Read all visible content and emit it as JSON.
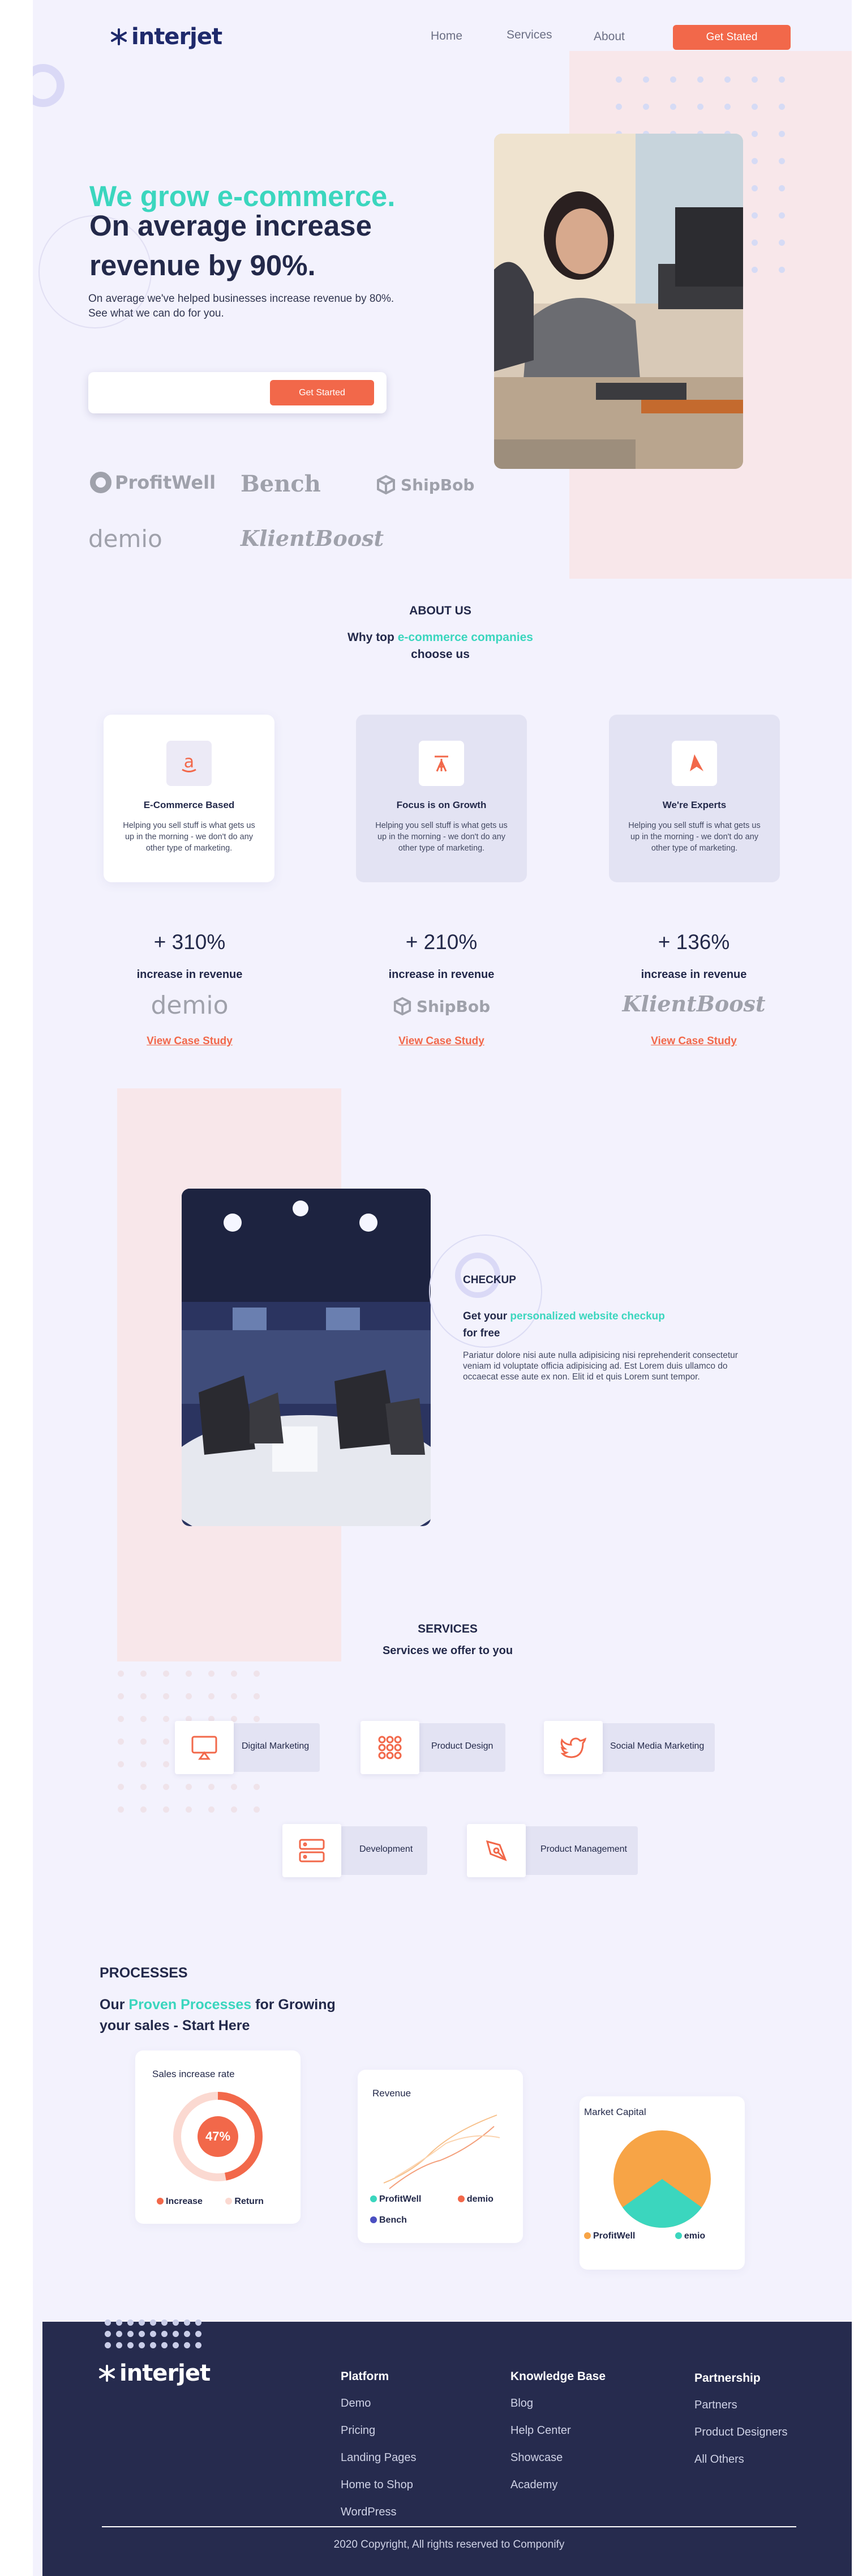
{
  "brand": {
    "logo_text": "interjet"
  },
  "nav": {
    "items": [
      "Home",
      "Services",
      "About"
    ],
    "cta": "Get Stated"
  },
  "hero": {
    "line1": "We grow e-commerce.",
    "line2": "On average increase",
    "line3": "revenue by 90%.",
    "sub1": "On average we've helped businesses increase revenue by 80%.",
    "sub2": "See what we can do for you.",
    "input_value": "",
    "cta": "Get Started"
  },
  "logos": [
    "ProfitWell",
    "Bench",
    "ShipBob",
    "demio",
    "KlientBoost"
  ],
  "about": {
    "eyebrow": "ABOUT US",
    "head_pre": "Why top ",
    "head_hl": "e-commerce companies",
    "head_post": "choose us",
    "cards": [
      {
        "title": "E-Commerce Based",
        "desc": "Helping you sell stuff is what gets us up in the morning - we don't do any other type of marketing."
      },
      {
        "title": "Focus is on Growth",
        "desc": "Helping you sell stuff is what gets us up in the morning - we don't do any other type of marketing."
      },
      {
        "title": "We're Experts",
        "desc": "Helping you sell stuff is what gets us up in the morning - we don't do any other type of marketing."
      }
    ]
  },
  "stats": [
    {
      "value": "+ 310%",
      "label": "increase in revenue",
      "brand": "demio",
      "link": "View Case Study"
    },
    {
      "value": "+ 210%",
      "label": "increase in revenue",
      "brand": "ShipBob",
      "link": "View Case Study"
    },
    {
      "value": "+ 136%",
      "label": "increase in revenue",
      "brand": "KlientBoost",
      "link": "View Case Study"
    }
  ],
  "checkup": {
    "eyebrow": "CHECKUP",
    "head_pre": "Get your ",
    "head_hl": "personalized website checkup",
    "head_post": "for free",
    "body": "Pariatur dolore nisi aute nulla adipisicing nisi reprehenderit consectetur veniam id voluptate officia adipisicing ad. Est Lorem duis ullamco do occaecat esse aute ex non. Elit id et quis Lorem sunt tempor."
  },
  "services": {
    "eyebrow": "SERVICES",
    "head": "Services we offer to you",
    "items": [
      "Digital Marketing",
      "Product Design",
      "Social Media Marketing",
      "Development",
      "Product Management"
    ]
  },
  "processes": {
    "eyebrow": "PROCESSES",
    "head_pre": "Our ",
    "head_hl": "Proven Processes",
    "head_post": " for Growing",
    "head_line2": "your sales - Start Here",
    "cards": {
      "sales": {
        "title": "Sales increase rate",
        "percent_label": "47%",
        "percent": 0.47,
        "legend": [
          "Increase",
          "Return"
        ]
      },
      "revenue": {
        "title": "Revenue",
        "legend": [
          "ProfitWell",
          "demio",
          "Bench"
        ]
      },
      "market": {
        "title": "Market Capital",
        "legend": [
          "ProfitWell",
          "emio"
        ]
      }
    }
  },
  "colors": {
    "accent": "#f2684a",
    "teal": "#3bd6be",
    "navy": "#262b4e",
    "bg": "#f3f2fd"
  },
  "footer": {
    "logo_text": "interjet",
    "cols": [
      {
        "head": "Platform",
        "links": [
          "Demo",
          "Pricing",
          "Landing Pages",
          "Home to Shop",
          "WordPress"
        ]
      },
      {
        "head": "Knowledge Base",
        "links": [
          "Blog",
          "Help Center",
          "Showcase",
          "Academy"
        ]
      },
      {
        "head": "Partnership",
        "links": [
          "Partners",
          "Product Designers",
          "All Others"
        ]
      }
    ],
    "copyright": "2020 Copyright, All rights reserved to Componify"
  }
}
